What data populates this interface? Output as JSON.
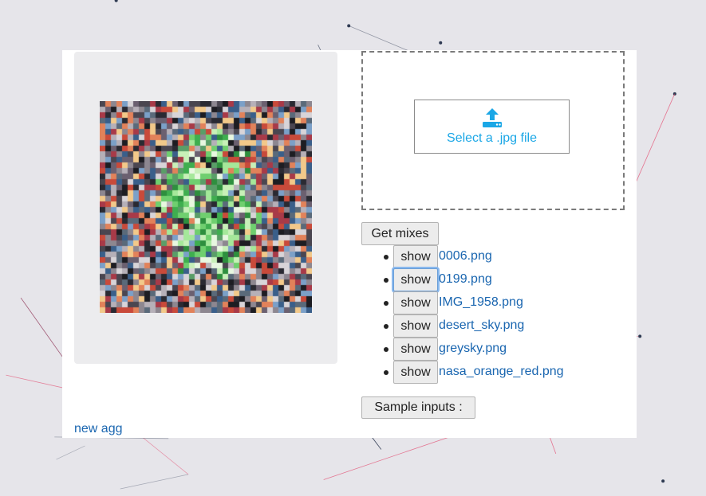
{
  "colors": {
    "background": "#e6e5ea",
    "panel": "#ffffff",
    "accent": "#1ba7e6",
    "link": "#1a66b0",
    "network_lines": [
      "#e3365f",
      "#2f3a52"
    ]
  },
  "upload": {
    "icon": "upload-icon",
    "label": "Select a .jpg file"
  },
  "actions": {
    "get_mixes": "Get mixes",
    "sample_inputs": "Sample inputs :"
  },
  "mixes": [
    {
      "button": "show",
      "name": "0006.png"
    },
    {
      "button": "show",
      "name": "0199.png"
    },
    {
      "button": "show",
      "name": "IMG_1958.png"
    },
    {
      "button": "show",
      "name": "desert_sky.png"
    },
    {
      "button": "show",
      "name": "greysky.png"
    },
    {
      "button": "show",
      "name": "nasa_orange_red.png"
    }
  ],
  "footer": {
    "new_agg": "new agg"
  }
}
